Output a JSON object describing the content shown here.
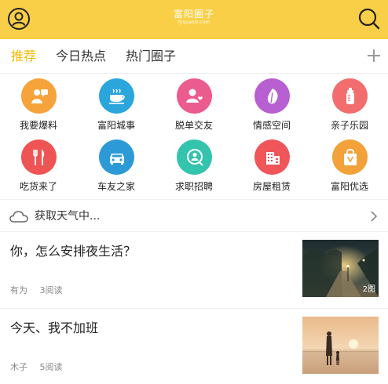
{
  "header": {
    "logo_main": "富阳圈子",
    "logo_sub": "fyquanzi.com",
    "bg_color": "#f9cf47"
  },
  "tabs": [
    {
      "label": "推荐",
      "active": true
    },
    {
      "label": "今日热点",
      "active": false
    },
    {
      "label": "热门圈子",
      "active": false
    }
  ],
  "categories": [
    {
      "label": "我要爆料",
      "icon": "reporter-icon",
      "color": "#f5a33a"
    },
    {
      "label": "富阳城事",
      "icon": "coffee-cup-icon",
      "color": "#2aa6dd"
    },
    {
      "label": "脱单交友",
      "icon": "person-heart-icon",
      "color": "#ec5b8d"
    },
    {
      "label": "情感空间",
      "icon": "leaf-heart-icon",
      "color": "#b85fd1"
    },
    {
      "label": "亲子乐园",
      "icon": "baby-bottle-icon",
      "color": "#f26d6d"
    },
    {
      "label": "吃货来了",
      "icon": "fork-knife-icon",
      "color": "#ef5454"
    },
    {
      "label": "车友之家",
      "icon": "car-icon",
      "color": "#2d9ad8"
    },
    {
      "label": "求职招聘",
      "icon": "job-search-icon",
      "color": "#34c3ad"
    },
    {
      "label": "房屋租赁",
      "icon": "building-icon",
      "color": "#f0555a"
    },
    {
      "label": "富阳优选",
      "icon": "shopping-bag-icon",
      "color": "#f3a23a"
    }
  ],
  "weather": {
    "text": "获取天气中..."
  },
  "articles": [
    {
      "title": "你，怎么安排夜生活？",
      "author": "有为",
      "reads": "3阅读",
      "badge": "2图",
      "thumb": "night-street-image"
    },
    {
      "title": "今天、我不加班",
      "author": "木子",
      "reads": "5阅读",
      "badge": "",
      "thumb": "beach-sunset-image"
    }
  ]
}
